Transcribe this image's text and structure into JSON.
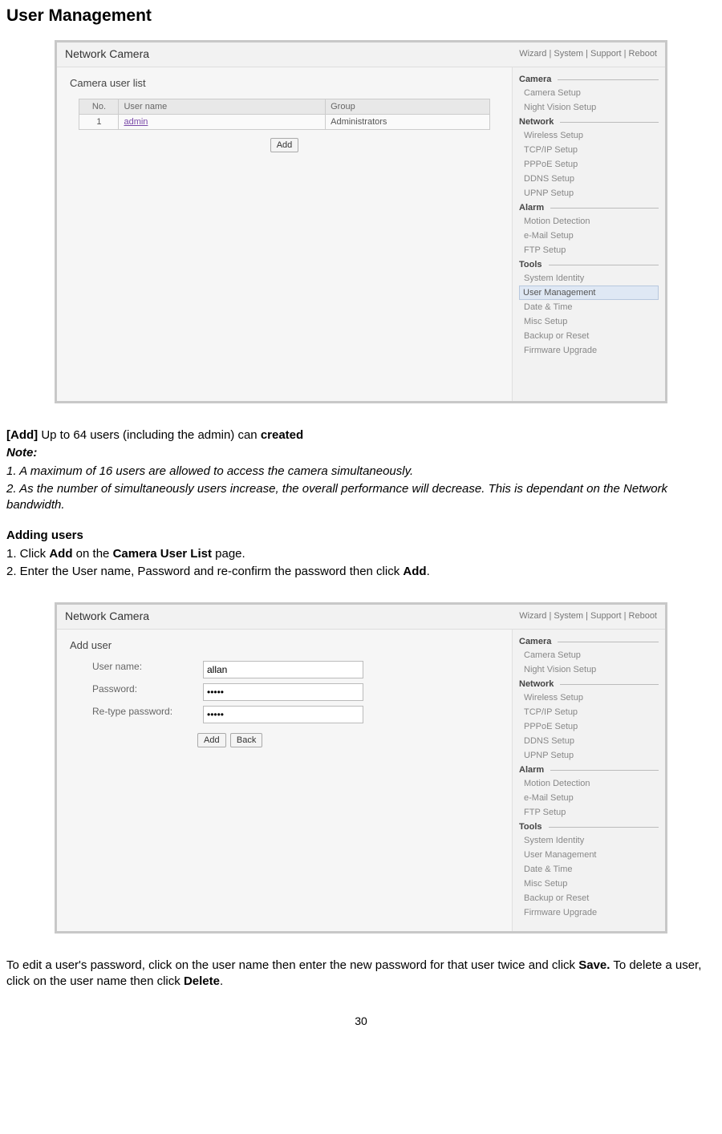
{
  "page_title": "User Management",
  "footer_page_number": "30",
  "screenshot_common": {
    "brand": "Network Camera",
    "topbar_links": "Wizard  |  System  |  Support  |  Reboot",
    "sidebar": {
      "groups": [
        {
          "title": "Camera",
          "items": [
            "Camera Setup",
            "Night Vision Setup"
          ]
        },
        {
          "title": "Network",
          "items": [
            "Wireless Setup",
            "TCP/IP Setup",
            "PPPoE Setup",
            "DDNS Setup",
            "UPNP Setup"
          ]
        },
        {
          "title": "Alarm",
          "items": [
            "Motion Detection",
            "e-Mail Setup",
            "FTP Setup"
          ]
        },
        {
          "title": "Tools",
          "items": [
            "System Identity",
            "User Management",
            "Date & Time",
            "Misc Setup",
            "Backup or Reset",
            "Firmware Upgrade"
          ]
        }
      ]
    }
  },
  "screenshot1": {
    "panel_title": "Camera user list",
    "table": {
      "headers": [
        "No.",
        "User name",
        "Group"
      ],
      "row": {
        "no": "1",
        "user": "admin",
        "group": "Administrators"
      }
    },
    "add_button": "Add",
    "selected_sidebar": "User Management"
  },
  "screenshot2": {
    "panel_title": "Add user",
    "labels": {
      "username": "User name:",
      "password": "Password:",
      "retype": "Re-type password:"
    },
    "values": {
      "username": "allan",
      "password": "•••••",
      "retype": "•••••"
    },
    "buttons": {
      "add": "Add",
      "back": "Back"
    }
  },
  "doc": {
    "add_line_prefix": "[Add] ",
    "add_line_mid": "Up to 64 users (including the admin) can ",
    "add_line_bold": "created",
    "note_heading": "Note:",
    "note1": "1. A maximum of 16 users are allowed to access the camera simultaneously.",
    "note2": "2. As the number of simultaneously users increase, the overall performance will decrease. This is dependant on the Network bandwidth.",
    "adding_heading": "Adding users",
    "step1_pre": "1. Click ",
    "step1_b1": "Add",
    "step1_mid": " on the ",
    "step1_b2": "Camera User List",
    "step1_post": " page.",
    "step2_pre": "2. Enter the User name, Password and re-confirm the password then click ",
    "step2_b": "Add",
    "step2_post": ".",
    "tail_pre": "To edit a user's password, click on the user name then enter the new password for that user twice and click ",
    "tail_b1": "Save.",
    "tail_mid": " To delete a user, click on the user name then click ",
    "tail_b2": "Delete",
    "tail_post": "."
  }
}
